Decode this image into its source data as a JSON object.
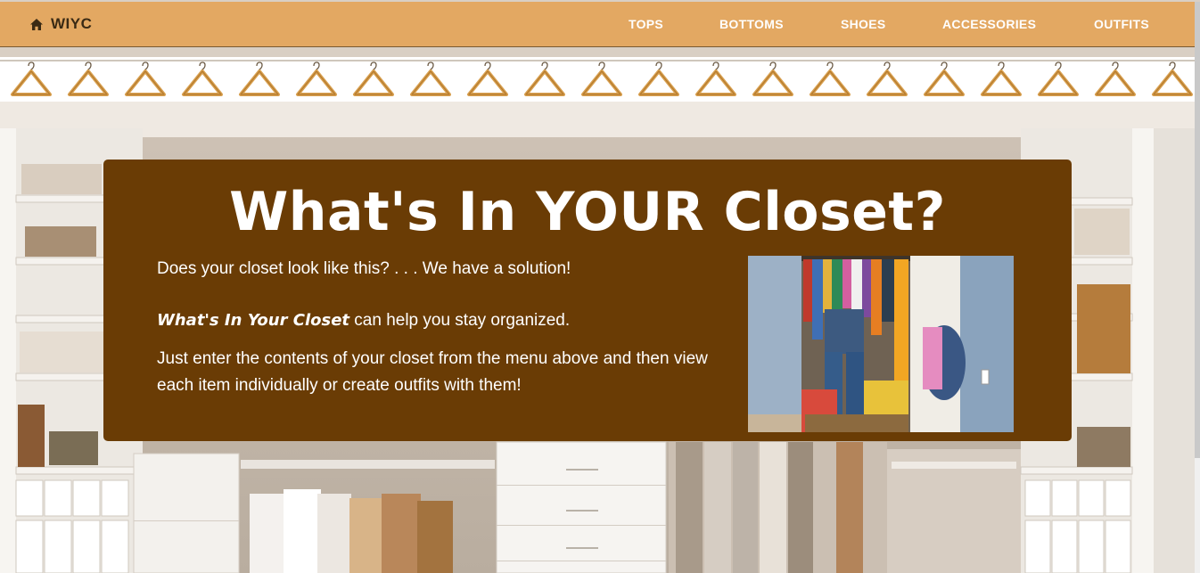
{
  "brand": {
    "icon": "home-icon",
    "label": "WIYC"
  },
  "nav": {
    "items": [
      {
        "label": "TOPS"
      },
      {
        "label": "BOTTOMS"
      },
      {
        "label": "SHOES"
      },
      {
        "label": "ACCESSORIES"
      },
      {
        "label": "OUTFITS"
      }
    ]
  },
  "carousel": {
    "prev_icon": "chevron-left-icon"
  },
  "hero": {
    "title": "What's In YOUR Closet?",
    "line1": "Does your closet look like this? . . . We have a solution!",
    "line2_emphasis": "What's In Your Closet",
    "line2_rest": " can help you stay organized.",
    "line3": "Just enter the contents of your closet from the menu above and then view each item individually or create outfits with them!"
  },
  "colors": {
    "navbar": "#e3a862",
    "brand_text": "#3a2a14",
    "card": "#6a3c05",
    "text": "#ffffff"
  }
}
